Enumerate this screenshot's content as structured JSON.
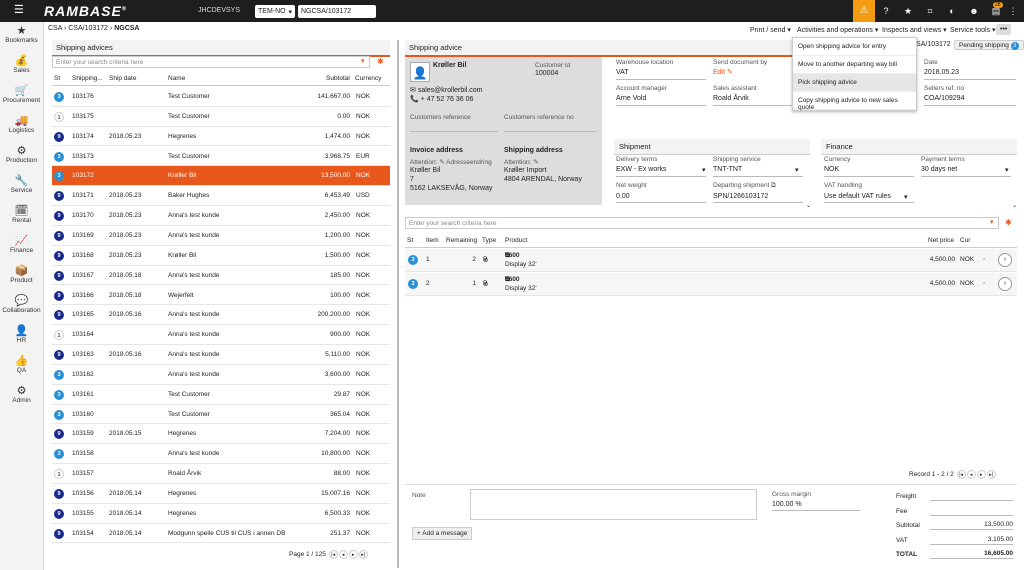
{
  "topbar": {
    "menu": "☰",
    "logo": "RAMBASE",
    "registered": "®",
    "db": "JHCDEVSYS",
    "company": "TEM-NO",
    "search": "NGCSA/103172",
    "badge": "28",
    "icons": [
      "warning-icon",
      "help-icon",
      "star-icon",
      "tag-icon",
      "user-icon",
      "inbox-icon",
      "more-icon"
    ]
  },
  "sidebar": [
    {
      "label": "Bookmarks",
      "icon": "★"
    },
    {
      "label": "Sales",
      "icon": "💰"
    },
    {
      "label": "Procurement",
      "icon": "🛒"
    },
    {
      "label": "Logistics",
      "icon": "🚚"
    },
    {
      "label": "Production",
      "icon": "⚙"
    },
    {
      "label": "Service",
      "icon": "🔧"
    },
    {
      "label": "Rental",
      "icon": "🗓"
    },
    {
      "label": "Finance",
      "icon": "📈"
    },
    {
      "label": "Product",
      "icon": "📦"
    },
    {
      "label": "Collaboration",
      "icon": "💬"
    },
    {
      "label": "HR",
      "icon": "👤"
    },
    {
      "label": "QA",
      "icon": "👍"
    },
    {
      "label": "Admin",
      "icon": "⚙"
    }
  ],
  "breadcrumb": {
    "a": "CSA",
    "b": "CSA/103172",
    "c": "NGCSA"
  },
  "toolbar": {
    "print": "Print / send",
    "activities": "Activities and operations",
    "inspects": "Inspects and views",
    "service": "Service tools",
    "more": "•••"
  },
  "dropdown": [
    "Open shipping advice for entry",
    "Move to another departing way bill",
    "Pick shipping advice",
    "Copy shipping advice to new sales quote"
  ],
  "pending": {
    "id": "CSA/103172",
    "status": "Pending shipping",
    "num": "3"
  },
  "left": {
    "title": "Shipping advices",
    "search_placeholder": "Enter your search criteria here",
    "headers": {
      "st": "St",
      "id": "Shipping...",
      "date": "Ship date",
      "name": "Name",
      "sub": "Subtotal",
      "cur": "Currency"
    },
    "rows": [
      {
        "st": "3",
        "id": "103176",
        "date": "",
        "name": "Test Customer",
        "sub": "141,667.00",
        "cur": "NOK"
      },
      {
        "st": "1",
        "id": "103175",
        "date": "",
        "name": "Test Customer",
        "sub": "0.00",
        "cur": "NOK"
      },
      {
        "st": "9",
        "id": "103174",
        "date": "2018.05.23",
        "name": "Hegrenes",
        "sub": "1,474.00",
        "cur": "NOK"
      },
      {
        "st": "3",
        "id": "103173",
        "date": "",
        "name": "Test Customer",
        "sub": "3,968.75",
        "cur": "EUR"
      },
      {
        "st": "3",
        "id": "103172",
        "date": "",
        "name": "Krøller Bil",
        "sub": "13,500.00",
        "cur": "NOK"
      },
      {
        "st": "9",
        "id": "103171",
        "date": "2018.05.23",
        "name": "Baker Hughes",
        "sub": "6,453.49",
        "cur": "USD"
      },
      {
        "st": "9",
        "id": "103170",
        "date": "2018.05.23",
        "name": "Anna's test kunde",
        "sub": "2,450.00",
        "cur": "NOK"
      },
      {
        "st": "9",
        "id": "103169",
        "date": "2018.05.23",
        "name": "Anna's test kunde",
        "sub": "1,200.00",
        "cur": "NOK"
      },
      {
        "st": "9",
        "id": "103168",
        "date": "2018.05.23",
        "name": "Krøller Bil",
        "sub": "1,500.00",
        "cur": "NOK"
      },
      {
        "st": "9",
        "id": "103167",
        "date": "2018.05.18",
        "name": "Anna's test kunde",
        "sub": "185.00",
        "cur": "NOK"
      },
      {
        "st": "9",
        "id": "103166",
        "date": "2018.05.18",
        "name": "Wejerfelt",
        "sub": "100.00",
        "cur": "NOK"
      },
      {
        "st": "9",
        "id": "103165",
        "date": "2018.05.16",
        "name": "Anna's test kunde",
        "sub": "200,200.00",
        "cur": "NOK"
      },
      {
        "st": "1",
        "id": "103164",
        "date": "",
        "name": "Anna's test kunde",
        "sub": "900.00",
        "cur": "NOK"
      },
      {
        "st": "9",
        "id": "103163",
        "date": "2018.05.16",
        "name": "Anna's test kunde",
        "sub": "5,110.00",
        "cur": "NOK"
      },
      {
        "st": "3",
        "id": "103162",
        "date": "",
        "name": "Anna's test kunde",
        "sub": "3,600.00",
        "cur": "NOK"
      },
      {
        "st": "3",
        "id": "103161",
        "date": "",
        "name": "Test Customer",
        "sub": "29.87",
        "cur": "NOK"
      },
      {
        "st": "3",
        "id": "103160",
        "date": "",
        "name": "Test Customer",
        "sub": "365.04",
        "cur": "NOK"
      },
      {
        "st": "9",
        "id": "103159",
        "date": "2018.05.15",
        "name": "Hegrenes",
        "sub": "7,204.00",
        "cur": "NOK"
      },
      {
        "st": "3",
        "id": "103158",
        "date": "",
        "name": "Anna's test kunde",
        "sub": "10,800.00",
        "cur": "NOK"
      },
      {
        "st": "1",
        "id": "103157",
        "date": "",
        "name": "Roald Årvik",
        "sub": "88.00",
        "cur": "NOK"
      },
      {
        "st": "9",
        "id": "103156",
        "date": "2018.05.14",
        "name": "Hegrenes",
        "sub": "15,007.16",
        "cur": "NOK"
      },
      {
        "st": "9",
        "id": "103155",
        "date": "2018.05.14",
        "name": "Hegrenes",
        "sub": "6,500.33",
        "cur": "NOK"
      },
      {
        "st": "9",
        "id": "103154",
        "date": "2018.05.14",
        "name": "Modgunn speile CUS til CUS i annen DB",
        "sub": "251.37",
        "cur": "NOK"
      }
    ],
    "pager": "Page 1 / 125"
  },
  "right": {
    "title": "Shipping advice",
    "customer": {
      "name": "Krøller Bil",
      "id_label": "Customer id",
      "id": "100004",
      "email": "sales@krollerbil.com",
      "phone": "+ 47 52 76 36 06",
      "ref_label": "Customers reference",
      "refno_label": "Customers reference no"
    },
    "invoice": {
      "title": "Invoice address",
      "attn": "Attention:",
      "adr_label": "Adresseendring",
      "l1": "Krøller Bil",
      "l2": "7",
      "l3": "5162 LAKSEVÅG, Norway"
    },
    "shipping": {
      "title": "Shipping address",
      "attn": "Attention:",
      "l1": "Krøller Import",
      "l2": "4804 ARENDAL, Norway"
    },
    "fields": {
      "wh_label": "Warehouse location",
      "wh": "VAT",
      "send_label": "Send document by",
      "send": "Edit",
      "date_label": "Date",
      "date": "2018.05.23",
      "am_label": "Account manager",
      "am": "Arne Vold",
      "sa_label": "Sales assistant",
      "sa": "Roald Årvik",
      "sref_label": "Sellers ref. no",
      "sref": "COA/109294"
    },
    "shipment": {
      "title": "Shipment",
      "dt_label": "Delivery terms",
      "dt": "EXW - Ex works",
      "ss_label": "Shipping service",
      "ss": "TNT-TNT",
      "nw_label": "Net weight",
      "nw": "0.00",
      "dep_label": "Departing shipment",
      "dep": "SPN/1266103172"
    },
    "finance": {
      "title": "Finance",
      "cur_label": "Currency",
      "cur": "NOK",
      "pt_label": "Payment terms",
      "pt": "30 days net",
      "vat_label": "VAT handling",
      "vat": "Use default VAT rules"
    },
    "lines_search": "Enter your search criteria here",
    "line_headers": {
      "st": "St",
      "item": "Item",
      "rem": "Remaining",
      "type": "Type",
      "product": "Product",
      "np": "Net price",
      "cur": "Cur"
    },
    "lines": [
      {
        "st": "3",
        "item": "1",
        "rem": "2",
        "type": "P",
        "code": "5600",
        "desc": "Display 32'",
        "np": "4,500.00",
        "cur": "NOK"
      },
      {
        "st": "3",
        "item": "2",
        "rem": "1",
        "type": "P",
        "code": "5600",
        "desc": "Display 32'",
        "np": "4,500.00",
        "cur": "NOK"
      }
    ],
    "record": "Record 1 - 2 / 2",
    "note_label": "Note",
    "add_message": "Add a message",
    "gm_label": "Gross margin",
    "gm": "100.00 %",
    "totals": {
      "freight": "Freight",
      "fee": "Fee",
      "subtotal_label": "Subtotal",
      "subtotal": "13,500.00",
      "vat_label": "VAT",
      "vat": "3,105.00",
      "total_label": "TOTAL",
      "total": "16,605.00"
    }
  }
}
